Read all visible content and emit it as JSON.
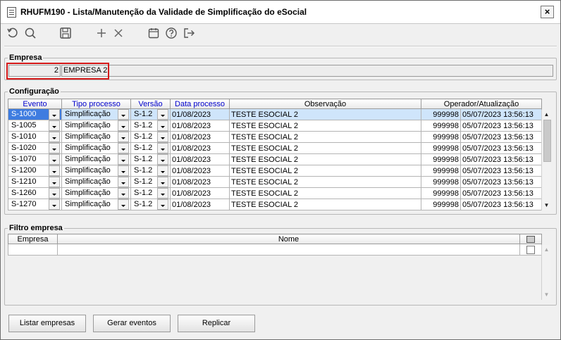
{
  "window": {
    "title": "RHUFM190 - Lista/Manutenção da Validade de Simplificação do eSocial",
    "close_glyph": "×"
  },
  "toolbar": {
    "icons": [
      "undo-icon",
      "search-icon",
      "save-icon",
      "add-icon",
      "delete-icon",
      "calendar-icon",
      "help-icon",
      "exit-icon"
    ]
  },
  "empresa": {
    "label": "Empresa",
    "code": "2",
    "name": "EMPRESA 2"
  },
  "configuracao": {
    "label": "Configuração",
    "columns": [
      "Evento",
      "Tipo processo",
      "Versão",
      "Data processo",
      "Observação",
      "Operador/Atualização"
    ],
    "rows": [
      {
        "evento": "S-1000",
        "tipo": "Simplificação",
        "versao": "S-1.2",
        "data": "01/08/2023",
        "obs": "TESTE ESOCIAL 2",
        "operador": "999998",
        "atualizacao": "05/07/2023 13:56:13"
      },
      {
        "evento": "S-1005",
        "tipo": "Simplificação",
        "versao": "S-1.2",
        "data": "01/08/2023",
        "obs": "TESTE ESOCIAL 2",
        "operador": "999998",
        "atualizacao": "05/07/2023 13:56:13"
      },
      {
        "evento": "S-1010",
        "tipo": "Simplificação",
        "versao": "S-1.2",
        "data": "01/08/2023",
        "obs": "TESTE ESOCIAL 2",
        "operador": "999998",
        "atualizacao": "05/07/2023 13:56:13"
      },
      {
        "evento": "S-1020",
        "tipo": "Simplificação",
        "versao": "S-1.2",
        "data": "01/08/2023",
        "obs": "TESTE ESOCIAL 2",
        "operador": "999998",
        "atualizacao": "05/07/2023 13:56:13"
      },
      {
        "evento": "S-1070",
        "tipo": "Simplificação",
        "versao": "S-1.2",
        "data": "01/08/2023",
        "obs": "TESTE ESOCIAL 2",
        "operador": "999998",
        "atualizacao": "05/07/2023 13:56:13"
      },
      {
        "evento": "S-1200",
        "tipo": "Simplificação",
        "versao": "S-1.2",
        "data": "01/08/2023",
        "obs": "TESTE ESOCIAL 2",
        "operador": "999998",
        "atualizacao": "05/07/2023 13:56:13"
      },
      {
        "evento": "S-1210",
        "tipo": "Simplificação",
        "versao": "S-1.2",
        "data": "01/08/2023",
        "obs": "TESTE ESOCIAL 2",
        "operador": "999998",
        "atualizacao": "05/07/2023 13:56:13"
      },
      {
        "evento": "S-1260",
        "tipo": "Simplificação",
        "versao": "S-1.2",
        "data": "01/08/2023",
        "obs": "TESTE ESOCIAL 2",
        "operador": "999998",
        "atualizacao": "05/07/2023 13:56:13"
      },
      {
        "evento": "S-1270",
        "tipo": "Simplificação",
        "versao": "S-1.2",
        "data": "01/08/2023",
        "obs": "TESTE ESOCIAL 2",
        "operador": "999998",
        "atualizacao": "05/07/2023 13:56:13"
      }
    ]
  },
  "filtro": {
    "label": "Filtro empresa",
    "columns": [
      "Empresa",
      "Nome"
    ]
  },
  "buttons": {
    "listar": "Listar empresas",
    "gerar": "Gerar eventos",
    "replicar": "Replicar"
  },
  "colors": {
    "selected_cell": "#3e7ce0",
    "selected_row": "#cfe5fb",
    "highlight_border": "#d41818",
    "header_link": "#0000cc"
  }
}
